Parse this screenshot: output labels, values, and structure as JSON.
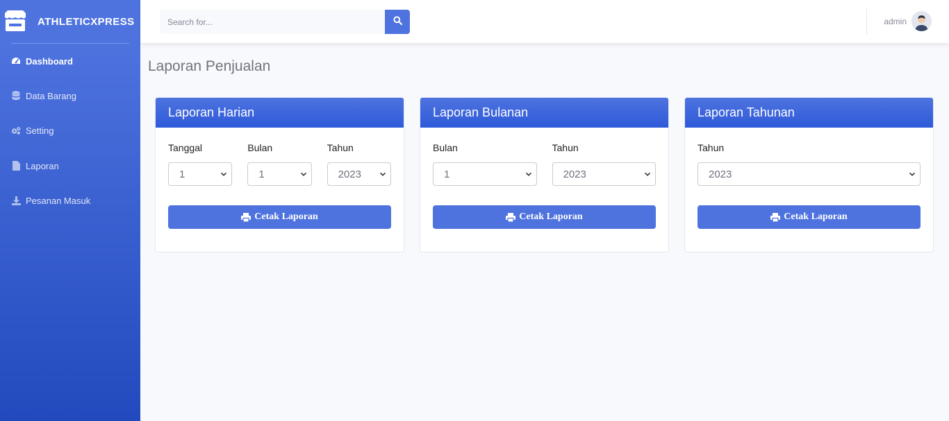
{
  "brand": {
    "name": "ATHLETICXPRESS",
    "icon": "store-icon"
  },
  "sidebar": {
    "items": [
      {
        "label": "Dashboard",
        "icon": "tachometer-icon",
        "active": true
      },
      {
        "label": "Data Barang",
        "icon": "database-icon",
        "active": false
      },
      {
        "label": "Setting",
        "icon": "cogs-icon",
        "active": false
      },
      {
        "label": "Laporan",
        "icon": "file-icon",
        "active": false
      },
      {
        "label": "Pesanan Masuk",
        "icon": "download-icon",
        "active": false
      }
    ]
  },
  "topbar": {
    "search_placeholder": "Search for...",
    "user_name": "admin"
  },
  "page": {
    "title": "Laporan Penjualan"
  },
  "cards": [
    {
      "title": "Laporan Harian",
      "fields": [
        {
          "label": "Tanggal",
          "value": "1"
        },
        {
          "label": "Bulan",
          "value": "1"
        },
        {
          "label": "Tahun",
          "value": "2023"
        }
      ],
      "button": "Cetak Laporan"
    },
    {
      "title": "Laporan Bulanan",
      "fields": [
        {
          "label": "Bulan",
          "value": "1"
        },
        {
          "label": "Tahun",
          "value": "2023"
        }
      ],
      "button": "Cetak Laporan"
    },
    {
      "title": "Laporan Tahunan",
      "fields": [
        {
          "label": "Tahun",
          "value": "2023"
        }
      ],
      "button": "Cetak Laporan"
    }
  ],
  "colors": {
    "primary": "#4e73df",
    "primary_dark": "#224abe",
    "background": "#f8f9fc"
  }
}
